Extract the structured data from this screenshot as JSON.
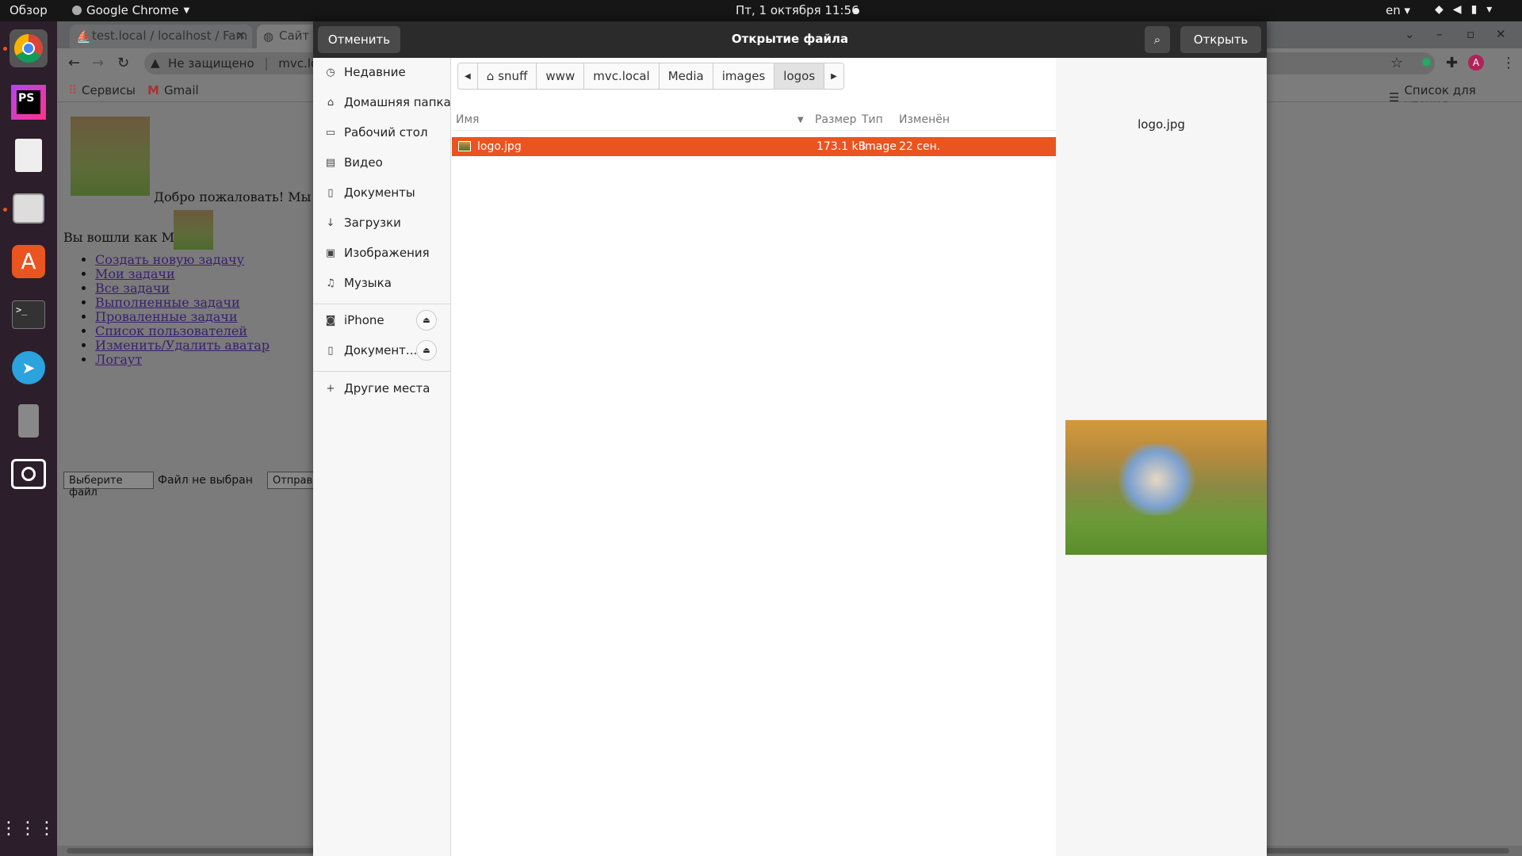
{
  "topbar": {
    "overview": "Обзор",
    "app_name": "Google Chrome",
    "clock": "Пт, 1 октября  11:56",
    "lang": "en"
  },
  "browser": {
    "tabs": [
      {
        "label": "test.local / localhost / Fam"
      },
      {
        "label": "Сайт м"
      }
    ],
    "security_label": "Не защищено",
    "url": "mvc.local/v",
    "bookmarks": {
      "apps": "Сервисы",
      "gmail": "Gmail",
      "reading_list": "Список для чтения"
    },
    "page": {
      "welcome": "Добро пожаловать! Мы - семь",
      "logged_in": "Вы вошли как Мама",
      "menu": [
        "Создать новую задачу",
        "Мои задачи",
        "Все задачи",
        "Выполненные задачи",
        "Проваленные задачи",
        "Список пользователей",
        "Изменить/Удалить аватар",
        "Логаут"
      ],
      "choose_file": "Выберите файл",
      "no_file": "Файл не выбран",
      "send": "Отправить"
    }
  },
  "dialog": {
    "title": "Открытие файла",
    "cancel": "Отменить",
    "open": "Открыть",
    "sidebar": [
      {
        "label": "Недавние",
        "icon": "clock-icon"
      },
      {
        "label": "Домашняя папка",
        "icon": "home-icon"
      },
      {
        "label": "Рабочий стол",
        "icon": "desktop-icon"
      },
      {
        "label": "Видео",
        "icon": "video-icon"
      },
      {
        "label": "Документы",
        "icon": "document-icon"
      },
      {
        "label": "Загрузки",
        "icon": "download-icon"
      },
      {
        "label": "Изображения",
        "icon": "image-icon"
      },
      {
        "label": "Музыка",
        "icon": "music-icon"
      },
      {
        "label": "iPhone",
        "icon": "camera-icon"
      },
      {
        "label": "Документ...",
        "icon": "phone-icon"
      },
      {
        "label": "Другие места",
        "icon": "plus-icon"
      }
    ],
    "path": [
      "snuff",
      "www",
      "mvc.local",
      "Media",
      "images",
      "logos"
    ],
    "columns": {
      "name": "Имя",
      "size": "Размер",
      "type": "Тип",
      "modified": "Изменён"
    },
    "files": [
      {
        "name": "logo.jpg",
        "size": "173.1 kB",
        "type": "Image",
        "modified": "22 сен."
      }
    ],
    "preview_name": "logo.jpg"
  },
  "colors": {
    "accent": "#e95420",
    "header": "#2b2b2b"
  }
}
